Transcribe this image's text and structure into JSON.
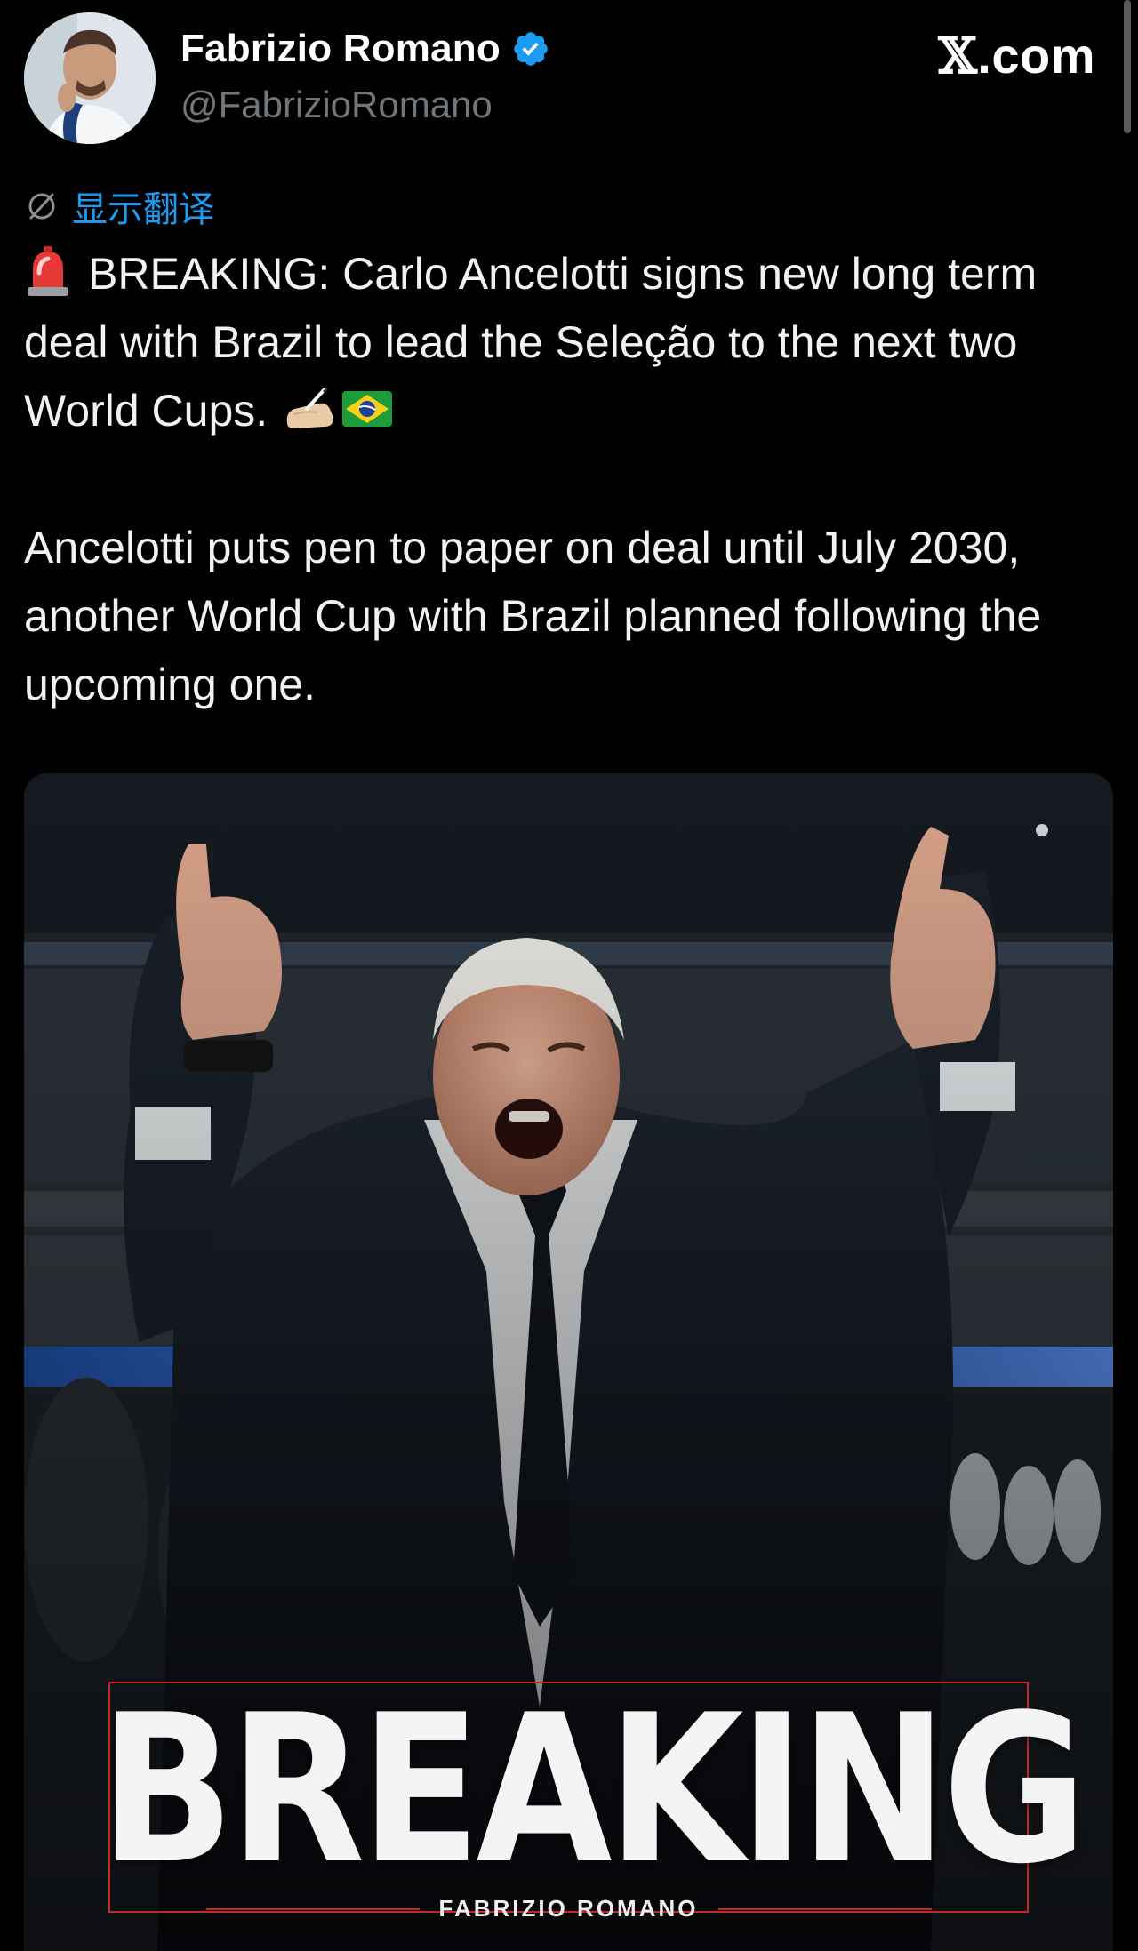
{
  "brand": {
    "prefix": "𝕏",
    "suffix": ".com"
  },
  "author": {
    "display_name": "Fabrizio Romano",
    "handle": "@FabrizioRomano",
    "verified": true,
    "verified_color": "#1d9bf0"
  },
  "translate": {
    "label": "显示翻译",
    "icon": "globe-slash-icon"
  },
  "tweet": {
    "line1": "BREAKING: Carlo Ancelotti signs new long term deal with Brazil to lead the Seleção to the next two World Cups.",
    "line2": "Ancelotti puts pen to paper on deal until July 2030, another World Cup with Brazil planned following the upcoming one.",
    "emojis": [
      "siren-emoji",
      "writing-hand-emoji",
      "brazil-flag-emoji"
    ]
  },
  "media": {
    "overlay_title": "BREAKING",
    "overlay_credit": "FABRIZIO ROMANO",
    "accent_color": "#c62828"
  },
  "colors": {
    "background": "#000000",
    "text": "#e7e9ea",
    "secondary_text": "#71767b",
    "link": "#1d9bf0"
  }
}
